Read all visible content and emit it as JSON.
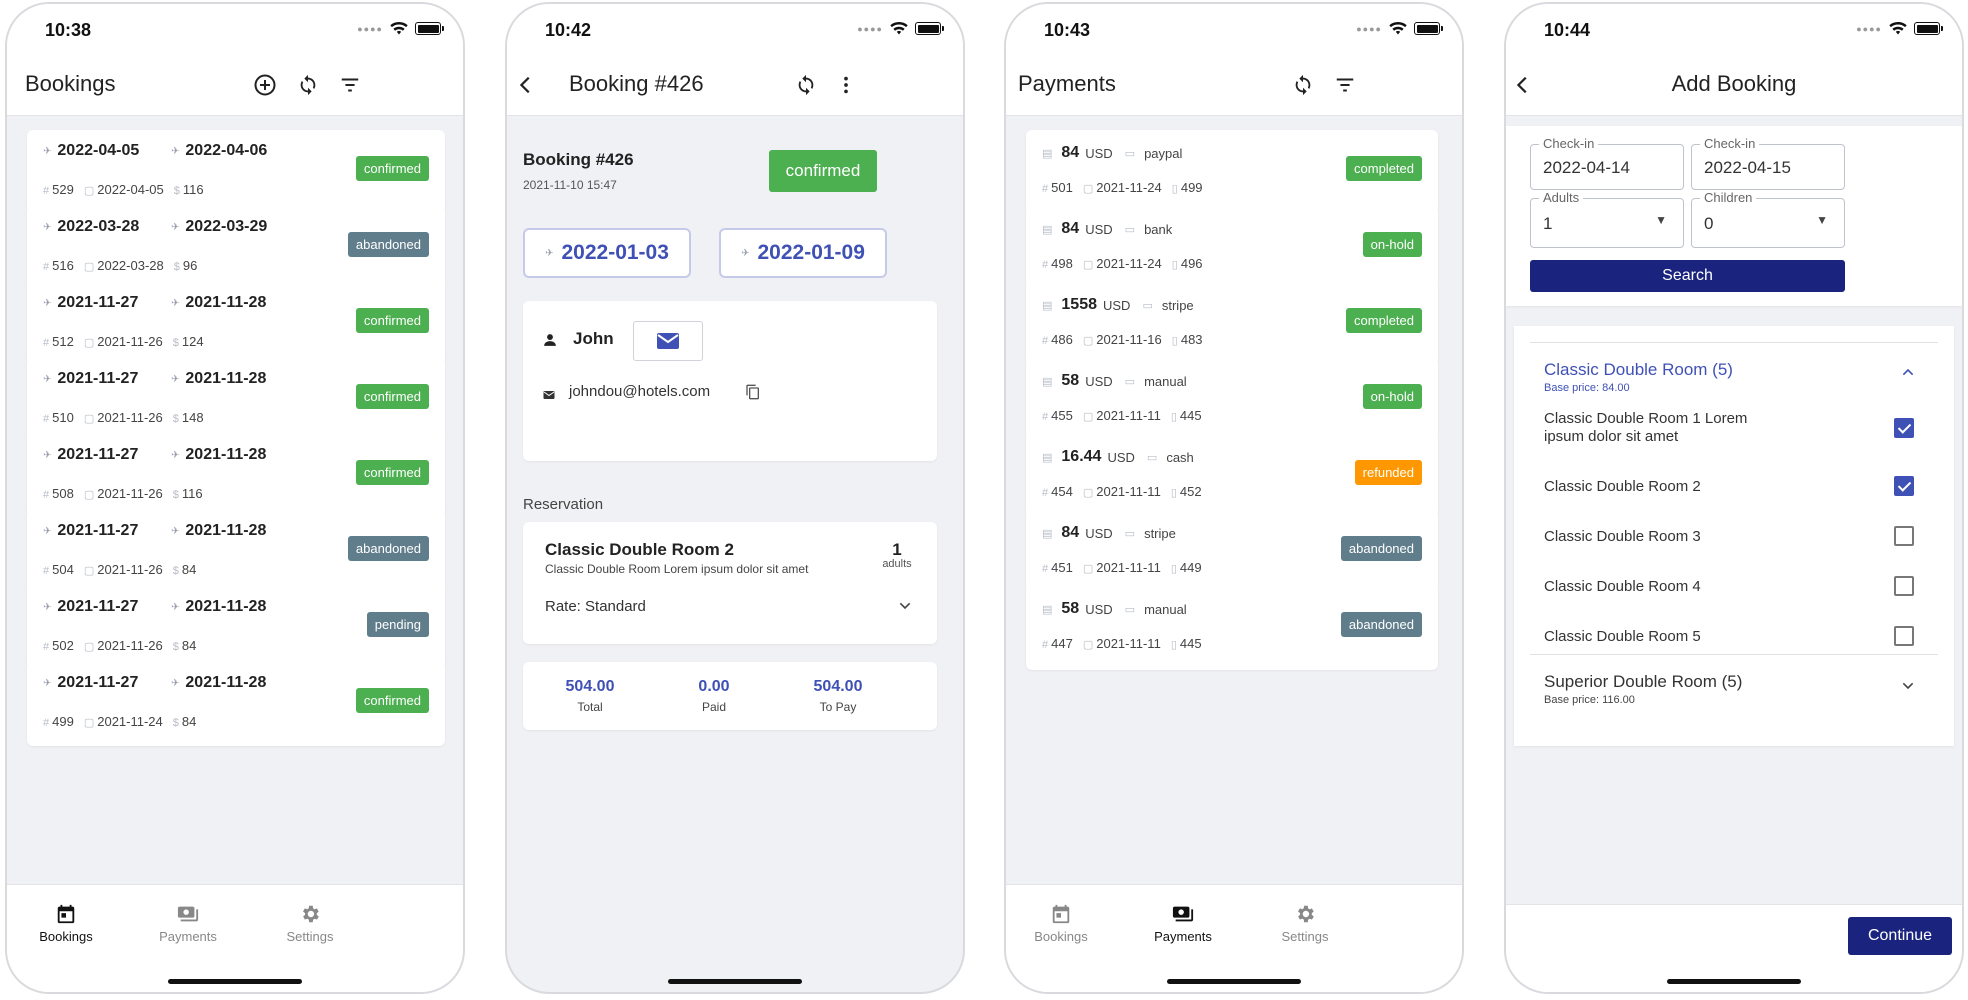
{
  "colors": {
    "confirmed": "#4caf50",
    "abandoned": "#607d8b",
    "pending": "#607d8b",
    "refunded": "#ff9800",
    "primary": "#1a237e",
    "accent": "#3f51b5"
  },
  "nav": {
    "bookings": "Bookings",
    "payments": "Payments",
    "settings": "Settings"
  },
  "screen1": {
    "time": "10:38",
    "title": "Bookings",
    "bookings": [
      {
        "checkin": "2022-04-05",
        "checkout": "2022-04-06",
        "id": "529",
        "created": "2022-04-05",
        "amount": "116",
        "status": "confirmed"
      },
      {
        "checkin": "2022-03-28",
        "checkout": "2022-03-29",
        "id": "516",
        "created": "2022-03-28",
        "amount": "96",
        "status": "abandoned"
      },
      {
        "checkin": "2021-11-27",
        "checkout": "2021-11-28",
        "id": "512",
        "created": "2021-11-26",
        "amount": "124",
        "status": "confirmed"
      },
      {
        "checkin": "2021-11-27",
        "checkout": "2021-11-28",
        "id": "510",
        "created": "2021-11-26",
        "amount": "148",
        "status": "confirmed"
      },
      {
        "checkin": "2021-11-27",
        "checkout": "2021-11-28",
        "id": "508",
        "created": "2021-11-26",
        "amount": "116",
        "status": "confirmed"
      },
      {
        "checkin": "2021-11-27",
        "checkout": "2021-11-28",
        "id": "504",
        "created": "2021-11-26",
        "amount": "84",
        "status": "abandoned"
      },
      {
        "checkin": "2021-11-27",
        "checkout": "2021-11-28",
        "id": "502",
        "created": "2021-11-26",
        "amount": "84",
        "status": "pending"
      },
      {
        "checkin": "2021-11-27",
        "checkout": "2021-11-28",
        "id": "499",
        "created": "2021-11-24",
        "amount": "84",
        "status": "confirmed"
      }
    ]
  },
  "screen2": {
    "time": "10:42",
    "title": "Booking #426",
    "header_title": "Booking #426",
    "created": "2021-11-10 15:47",
    "status": "confirmed",
    "checkin": "2022-01-03",
    "checkout": "2022-01-09",
    "guest_name": "John",
    "guest_email": "johndou@hotels.com",
    "reservation_label": "Reservation",
    "room_name": "Classic Double Room 2",
    "room_desc": "Classic Double Room Lorem ipsum dolor sit amet",
    "adults_count": "1",
    "adults_label": "adults",
    "rate": "Rate: Standard",
    "total_value": "504.00",
    "total_label": "Total",
    "paid_value": "0.00",
    "paid_label": "Paid",
    "topay_value": "504.00",
    "topay_label": "To Pay"
  },
  "screen3": {
    "time": "10:43",
    "title": "Payments",
    "payments": [
      {
        "amount": "84",
        "currency": "USD",
        "method": "paypal",
        "id": "501",
        "date": "2021-11-24",
        "booking": "499",
        "status": "completed"
      },
      {
        "amount": "84",
        "currency": "USD",
        "method": "bank",
        "id": "498",
        "date": "2021-11-24",
        "booking": "496",
        "status": "on-hold"
      },
      {
        "amount": "1558",
        "currency": "USD",
        "method": "stripe",
        "id": "486",
        "date": "2021-11-16",
        "booking": "483",
        "status": "completed"
      },
      {
        "amount": "58",
        "currency": "USD",
        "method": "manual",
        "id": "455",
        "date": "2021-11-11",
        "booking": "445",
        "status": "on-hold"
      },
      {
        "amount": "16.44",
        "currency": "USD",
        "method": "cash",
        "id": "454",
        "date": "2021-11-11",
        "booking": "452",
        "status": "refunded"
      },
      {
        "amount": "84",
        "currency": "USD",
        "method": "stripe",
        "id": "451",
        "date": "2021-11-11",
        "booking": "449",
        "status": "abandoned"
      },
      {
        "amount": "58",
        "currency": "USD",
        "method": "manual",
        "id": "447",
        "date": "2021-11-11",
        "booking": "445",
        "status": "abandoned"
      }
    ]
  },
  "screen4": {
    "time": "10:44",
    "title": "Add Booking",
    "checkin_label": "Check-in",
    "checkin_value": "2022-04-14",
    "checkout_label": "Check-in",
    "checkout_value": "2022-04-15",
    "adults_label": "Adults",
    "adults_value": "1",
    "children_label": "Children",
    "children_value": "0",
    "search_label": "Search",
    "group1_title": "Classic Double Room (5)",
    "group1_price": "Base price: 84.00",
    "rooms": [
      {
        "name": "Classic Double Room 1 Lorem ipsum dolor sit amet",
        "checked": true
      },
      {
        "name": "Classic Double Room 2",
        "checked": true
      },
      {
        "name": "Classic Double Room 3",
        "checked": false
      },
      {
        "name": "Classic Double Room 4",
        "checked": false
      },
      {
        "name": "Classic Double Room 5",
        "checked": false
      }
    ],
    "group2_title": "Superior Double Room (5)",
    "group2_price": "Base price: 116.00",
    "continue_label": "Continue"
  }
}
